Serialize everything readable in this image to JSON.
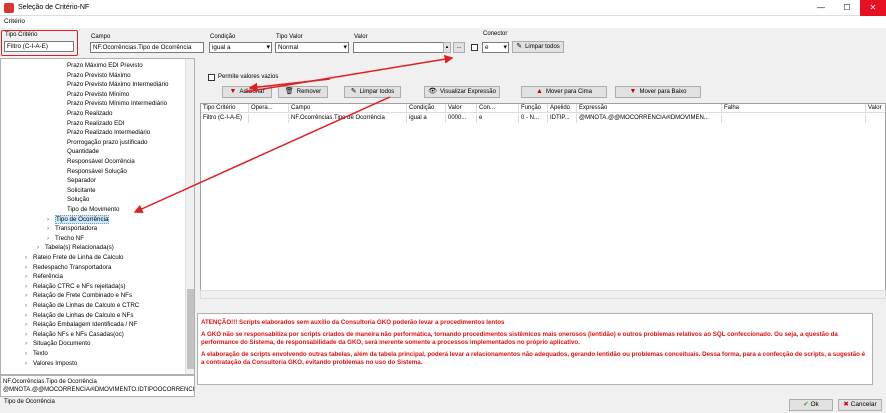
{
  "window": {
    "title": "Seleção de Critério-NF",
    "min": "—",
    "max": "☐",
    "close": "✕"
  },
  "menu": {
    "criterio": "Critério"
  },
  "filters": {
    "tipo_criterio_label": "Tipo Critério",
    "tipo_criterio_value": "Filtro (C-I-A-E)",
    "campo_label": "Campo",
    "campo_value": "NF.Ocorrências.Tipo de Ocorrência",
    "condicao_label": "Condição",
    "condicao_value": "igual a",
    "tipo_valor_label": "Tipo Valor",
    "tipo_valor_value": "Normal",
    "valor_label": "Valor",
    "valor_value": "",
    "ellipsis": "...",
    "conector_label": "Conector",
    "conector_value": "e",
    "limpar_todos": "Limpar todos"
  },
  "options": {
    "permite_valores_vazios": "Permite valores vazios"
  },
  "actions": {
    "adicionar": "Adicionar",
    "remover": "Remover",
    "limpar_todos": "Limpar todos",
    "visualizar": "Visualizar Expressão",
    "mover_cima": "Mover para Cima",
    "mover_baixo": "Mover para Baixo"
  },
  "tree": [
    "Prazo Máximo EDI Previsto",
    "Prazo Previsto Máximo",
    "Prazo Previsto Máximo Intermediário",
    "Prazo Previsto Mínimo",
    "Prazo Previsto Mínimo Intermediário",
    "Prazo Realizado",
    "Prazo Realizado EDI",
    "Prazo Realizado Intermediário",
    "Prorrogação prazo justificado",
    "Quantidade",
    "Responsável Ocorrência",
    "Responsável Solução",
    "Separador",
    "Solicitante",
    "Solução",
    "Tipo de Movimento",
    "Tipo de Ocorrência",
    "Transportadora",
    "Trecho NF",
    "Tabela(s) Relacionada(s)",
    "Rateio Frete de Linha de Calculo",
    "Redespacho Transportadora",
    "Referência",
    "Relação CTRC e NFs rejeitada(s)",
    "Relação de Frete Combinado e NFs",
    "Relação de Linhas de Calculo e CTRC",
    "Relação de Linhas de Calculo e NFs",
    "Relação Embalagem Identificada / NF",
    "Relação NFs e NFs Casadas(oc)",
    "Situação Documento",
    "Texto",
    "Valores Imposto"
  ],
  "expression": {
    "line1": "NF.Ocorrências.Tipo de Ocorrência",
    "line2": "@MNOTA.@@MOCORRENCIA#IDMOVIMENTO.IDTIPOOCORRENCIA"
  },
  "status_text": "Tipo de Ocorrência",
  "grid": {
    "headers": [
      "Tipo Critério",
      "Opera...",
      "Campo",
      "Condição",
      "Valor",
      "Con...",
      "Função",
      "Apelido",
      "Expressão",
      "Falha",
      "Valor"
    ],
    "row": [
      "Filtro (C-I-A-E)",
      "",
      "NF.Ocorrências.Tipo de Ocorrência",
      "igual a",
      "0000...",
      "e",
      "0 - N...",
      "IDTIP...",
      "@MNOTA.@@MOCORRENCIA#IDMOVIMEN...",
      "",
      ""
    ]
  },
  "warning": {
    "p1": "ATENÇÃO!!! Scripts elaborados sem auxílio da Consultoria GKO poderão levar a procedimentos lentos",
    "p2": "A GKO não se responsabiliza por scripts criados de maneira não performática, tornando procedimentos sistêmicos mais onerosos (lentidão) e outros problemas relativos ao SQL confeccionado. Ou seja, a questão da performance do Sistema, de responsabilidade da GKO, será inerente somente a processos implementados no próprio aplicativo.",
    "p3": "A elaboração de scripts envolvendo outras tabelas, além da tabela principal, poderá levar a relacionamentos não adequados, gerando lentidão ou problemas conceituais. Dessa forma, para a confecção de scripts, a sugestão é a contratação da Consultoria GKO, evitando problemas no uso do Sistema."
  },
  "footer": {
    "ok": "Ok",
    "cancelar": "Cancelar"
  },
  "colors": {
    "accent_red": "#e02020",
    "selection": "#cce8ff"
  }
}
